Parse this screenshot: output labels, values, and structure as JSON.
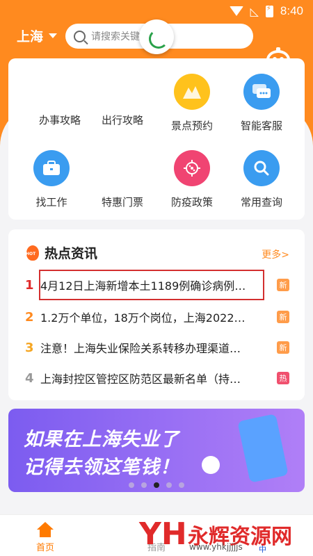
{
  "status_bar": {
    "time": "8:40"
  },
  "topbar": {
    "city": "上海",
    "search_placeholder": "请搜索关键"
  },
  "services": [
    {
      "label": "办事攻略"
    },
    {
      "label": "出行攻略"
    },
    {
      "label": "景点预约",
      "color": "#ffc21c"
    },
    {
      "label": "智能客服",
      "color": "#3a9cf0"
    },
    {
      "label": "找工作",
      "color": "#3a9cf0"
    },
    {
      "label": "特惠门票"
    },
    {
      "label": "防疫政策",
      "color": "#f04472"
    },
    {
      "label": "常用查询",
      "color": "#3a9cf0"
    }
  ],
  "hot_news": {
    "title": "热点资讯",
    "more": "更多>",
    "items": [
      {
        "rank": "1",
        "text": "4月12日上海新增本土1189例确诊病例…",
        "tag": "新",
        "rank_color": "#e02a2a",
        "tag_color": "#ff9c4a"
      },
      {
        "rank": "2",
        "text": "1.2万个单位，18万个岗位，上海2022…",
        "tag": "新",
        "rank_color": "#ff8a1f",
        "tag_color": "#ff9c4a"
      },
      {
        "rank": "3",
        "text": "注意！上海失业保险关系转移办理渠道…",
        "tag": "新",
        "rank_color": "#f5a623",
        "tag_color": "#ff9c4a"
      },
      {
        "rank": "4",
        "text": "上海封控区管控区防范区最新名单（持…",
        "tag": "热",
        "rank_color": "#999999",
        "tag_color": "#f0506e"
      }
    ]
  },
  "banner": {
    "line1": "如果在上海失业了",
    "line2": "记得去领这笔钱！",
    "active_dot": 3
  },
  "bottom_nav": [
    {
      "label": "首页"
    },
    {
      "label": "指南"
    }
  ],
  "watermark": {
    "text": "永辉资源网",
    "url": "www.yhkjjjjjs",
    "corner": "中"
  }
}
